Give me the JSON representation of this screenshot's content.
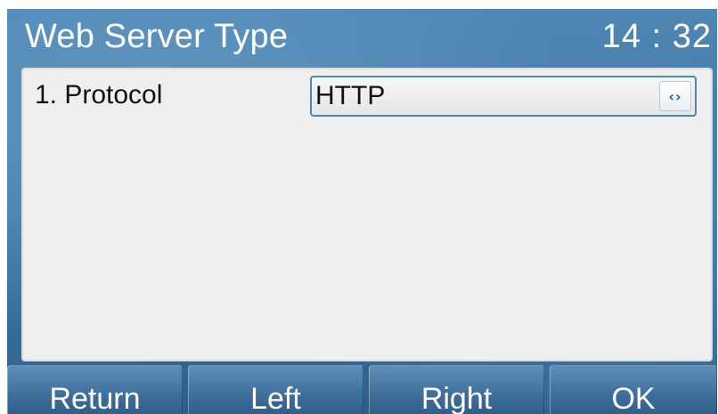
{
  "header": {
    "title": "Web Server Type",
    "time": "14 : 32"
  },
  "settings": {
    "items": [
      {
        "label": "1. Protocol",
        "value": "HTTP",
        "switch_icon": "left-right-arrows-icon",
        "switch_glyph": "‹›"
      }
    ]
  },
  "softkeys": [
    {
      "label": "Return"
    },
    {
      "label": "Left"
    },
    {
      "label": "Right"
    },
    {
      "label": "OK"
    }
  ],
  "colors": {
    "accent": "#4b86b8",
    "background": "#3f77a6",
    "panel": "#efefef"
  }
}
